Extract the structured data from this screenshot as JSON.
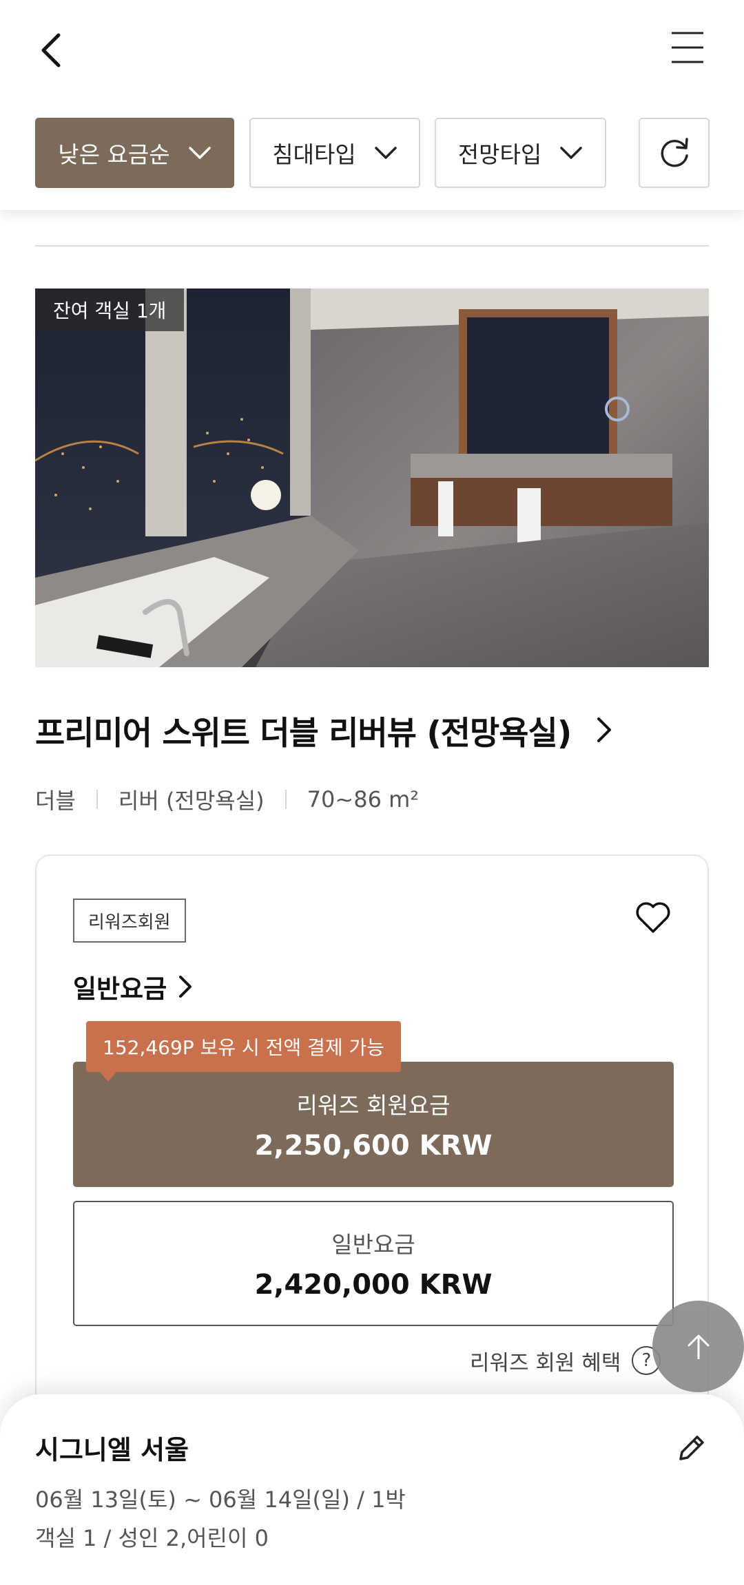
{
  "header": {
    "filters": [
      {
        "label": "낮은 요금순",
        "active": true
      },
      {
        "label": "침대타입",
        "active": false
      },
      {
        "label": "전망타입",
        "active": false
      }
    ]
  },
  "room": {
    "remaining_badge": "잔여 객실 1개",
    "title": "프리미어 스위트 더블 리버뷰 (전망욕실)",
    "bed_type": "더블",
    "view_type": "리버 (전망욕실)",
    "size": "70~86 m²"
  },
  "rate_card": {
    "member_tag": "리워즈회원",
    "rate_type": "일반요금",
    "points_tip": "152,469P 보유 시 전액 결제 가능",
    "member_price": {
      "label": "리워즈 회원요금",
      "value": "2,250,600 KRW"
    },
    "general_price": {
      "label": "일반요금",
      "value": "2,420,000 KRW"
    },
    "benefit_link": "리워즈 회원 혜택",
    "help_glyph": "?"
  },
  "bottom_sheet": {
    "hotel_name": "시그니엘 서울",
    "dates": "06월 13일(토) ~ 06월 14일(일) / 1박",
    "guests": "객실 1 / 성인 2,어린이 0"
  },
  "colors": {
    "accent_brown": "#7c6a5a",
    "tip_orange": "#c9704c"
  },
  "icons": [
    "back-arrow-icon",
    "hamburger-menu-icon",
    "chevron-down-icon",
    "refresh-icon",
    "chevron-right-icon",
    "heart-icon",
    "question-icon",
    "arrow-up-icon",
    "pencil-icon"
  ]
}
